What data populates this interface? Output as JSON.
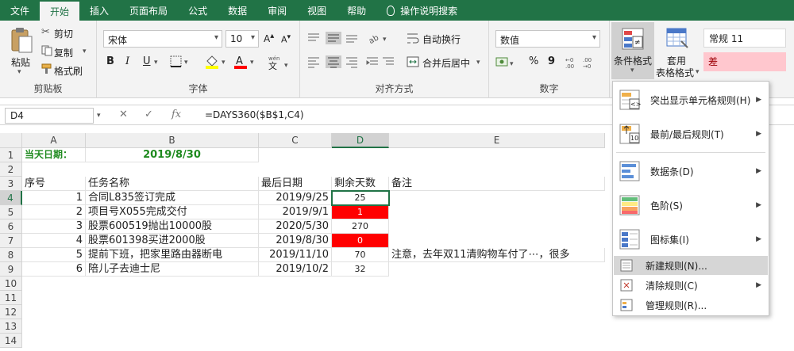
{
  "tabs": [
    "文件",
    "开始",
    "插入",
    "页面布局",
    "公式",
    "数据",
    "审阅",
    "视图",
    "帮助",
    "操作说明搜索"
  ],
  "active_tab": "开始",
  "ribbon": {
    "clipboard": {
      "paste": "粘贴",
      "cut": "剪切",
      "copy": "复制",
      "format_painter": "格式刷",
      "label": "剪贴板"
    },
    "font": {
      "name": "宋体",
      "size": "10",
      "bold": "B",
      "italic": "I",
      "underline": "U",
      "label": "字体"
    },
    "alignment": {
      "wrap": "自动换行",
      "merge": "合并后居中",
      "label": "对齐方式"
    },
    "number": {
      "format": "数值",
      "percent": "%",
      "comma": "9",
      "label": "数字"
    },
    "styles": {
      "cond_format": "条件格式",
      "table_format_1": "套用",
      "table_format_2": "表格格式",
      "normal": "常规 11",
      "bad": "差"
    }
  },
  "formula_bar": {
    "name_box": "D4",
    "formula": "=DAYS360($B$1,C4)"
  },
  "columns": [
    "A",
    "B",
    "C",
    "D",
    "E"
  ],
  "rows": [
    "1",
    "2",
    "3",
    "4",
    "5",
    "6",
    "7",
    "8",
    "9",
    "10",
    "11",
    "12",
    "13",
    "14"
  ],
  "sheet": {
    "a1": "当天日期：",
    "b1": "2019/8/30",
    "headers": {
      "a": "序号",
      "b": "任务名称",
      "c": "最后日期",
      "d": "剩余天数",
      "e": "备注"
    },
    "tasks": [
      {
        "n": "1",
        "name": "合同L835签订完成",
        "date": "2019/9/25",
        "days": "25"
      },
      {
        "n": "2",
        "name": "项目号X055完成交付",
        "date": "2019/9/1",
        "days": "1"
      },
      {
        "n": "3",
        "name": "股票600519抛出10000股",
        "date": "2020/5/30",
        "days": "270"
      },
      {
        "n": "4",
        "name": "股票601398买进2000股",
        "date": "2019/8/30",
        "days": "0"
      },
      {
        "n": "5",
        "name": "提前下班，把家里路由器断电",
        "date": "2019/11/10",
        "days": "70"
      },
      {
        "n": "6",
        "name": "陪儿子去迪士尼",
        "date": "2019/10/2",
        "days": "32"
      }
    ],
    "note_row8": "注意，去年双11清购物车付了⋯，很多"
  },
  "cf_menu": [
    {
      "label": "突出显示单元格规则(H)",
      "submenu": true
    },
    {
      "label": "最前/最后规则(T)",
      "submenu": true
    },
    {
      "label": "数据条(D)",
      "submenu": true
    },
    {
      "label": "色阶(S)",
      "submenu": true
    },
    {
      "label": "图标集(I)",
      "submenu": true
    },
    {
      "label": "新建规则(N)...",
      "submenu": false
    },
    {
      "label": "清除规则(C)",
      "submenu": true
    },
    {
      "label": "管理规则(R)...",
      "submenu": false
    }
  ],
  "colors": {
    "excel_green": "#217346",
    "cf_red": "#ff0000",
    "date_green": "#1e8a1e",
    "bad_style": "#ffc7ce"
  }
}
